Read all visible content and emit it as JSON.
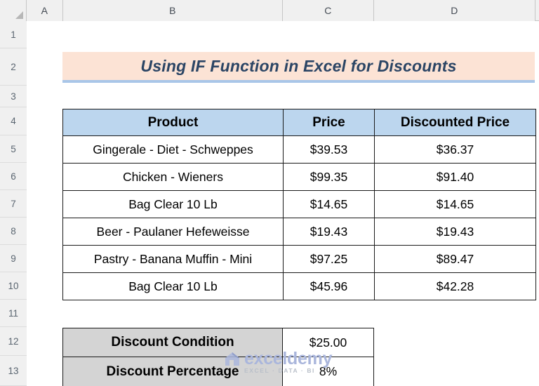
{
  "spreadsheet": {
    "columns": [
      "A",
      "B",
      "C",
      "D"
    ],
    "rows": [
      "1",
      "2",
      "3",
      "4",
      "5",
      "6",
      "7",
      "8",
      "9",
      "10",
      "11",
      "12",
      "13"
    ],
    "select_all_label": ""
  },
  "title_banner": {
    "text": "Using IF Function in Excel for Discounts",
    "background": "#fce3d5",
    "text_color": "#2b4565",
    "underline_color": "#a9c6e8"
  },
  "main_table": {
    "headers": [
      "Product",
      "Price",
      "Discounted Price"
    ],
    "header_background": "#bcd6ee",
    "rows": [
      {
        "product": "Gingerale - Diet - Schweppes",
        "price": "$39.53",
        "discounted": "$36.37"
      },
      {
        "product": "Chicken - Wieners",
        "price": "$99.35",
        "discounted": "$91.40"
      },
      {
        "product": "Bag Clear 10 Lb",
        "price": "$14.65",
        "discounted": "$14.65"
      },
      {
        "product": "Beer - Paulaner Hefeweisse",
        "price": "$19.43",
        "discounted": "$19.43"
      },
      {
        "product": "Pastry - Banana Muffin - Mini",
        "price": "$97.25",
        "discounted": "$89.47"
      },
      {
        "product": "Bag Clear 10 Lb",
        "price": "$45.96",
        "discounted": "$42.28"
      }
    ]
  },
  "condition_table": {
    "label_background": "#d4d4d4",
    "rows": [
      {
        "label": "Discount Condition",
        "value": "$25.00"
      },
      {
        "label": "Discount Percentage",
        "value": "8%"
      }
    ]
  },
  "watermark": {
    "word": "exceldemy",
    "tagline": "EXCEL · DATA · BI",
    "color": "#aab6dc"
  }
}
